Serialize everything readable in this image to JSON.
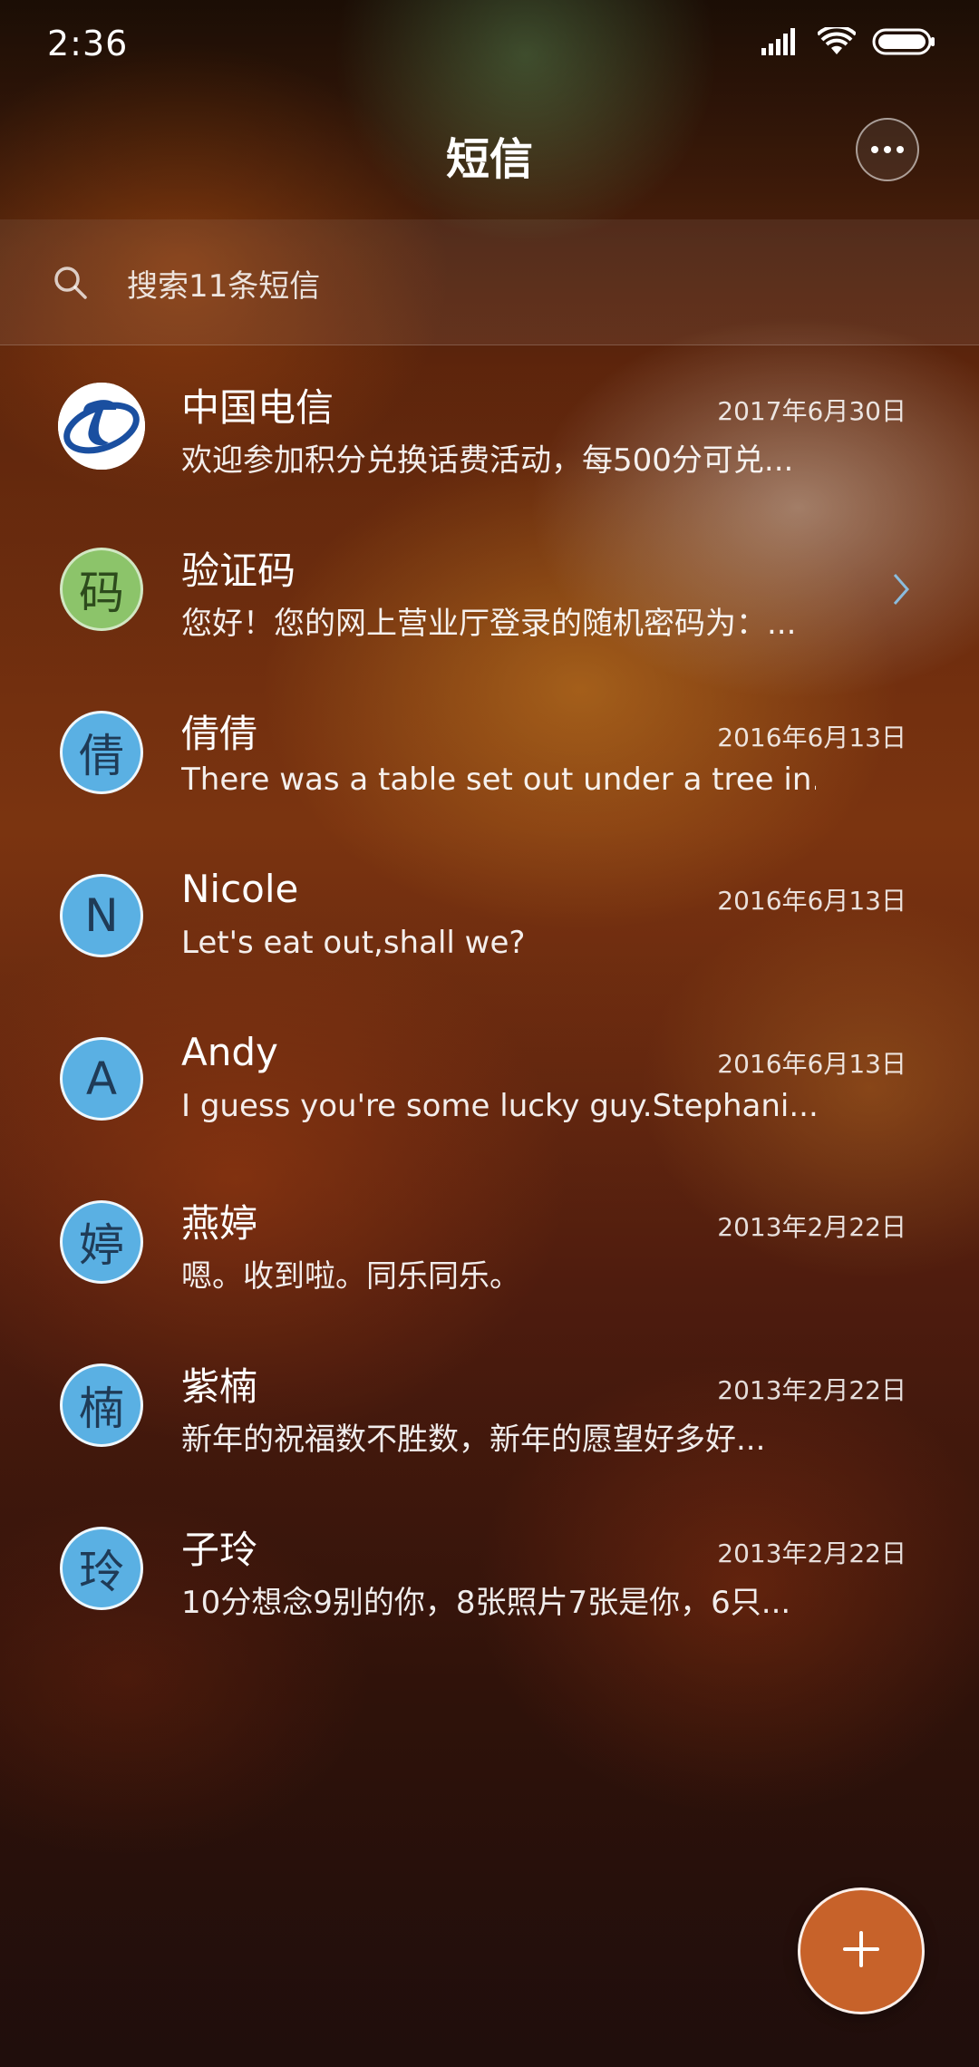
{
  "status_bar": {
    "time": "2:36"
  },
  "header": {
    "title": "短信"
  },
  "search": {
    "placeholder": "搜索11条短信"
  },
  "conversations": [
    {
      "name": "中国电信",
      "preview": "欢迎参加积分兑换话费活动，每500分可兑...",
      "date": "2017年6月30日",
      "avatar": "china-telecom-logo"
    },
    {
      "name": "验证码",
      "preview": "您好！您的网上营业厅登录的随机密码为：...",
      "date": "",
      "avatar_text": "码"
    },
    {
      "name": "倩倩",
      "preview": "There was a table set out under a tree in...",
      "date": "2016年6月13日",
      "avatar_text": "倩"
    },
    {
      "name": "Nicole",
      "preview": "Let's eat out,shall we?",
      "date": "2016年6月13日",
      "avatar_text": "N"
    },
    {
      "name": "Andy",
      "preview": "I guess you're some lucky guy.Stephani...",
      "date": "2016年6月13日",
      "avatar_text": "A"
    },
    {
      "name": "燕婷",
      "preview": "嗯。收到啦。同乐同乐。",
      "date": "2013年2月22日",
      "avatar_text": "婷"
    },
    {
      "name": "紫楠",
      "preview": "新年的祝福数不胜数，新年的愿望好多好...",
      "date": "2013年2月22日",
      "avatar_text": "楠"
    },
    {
      "name": "子玲",
      "preview": "10分想念9别的你，8张照片7张是你，6只...",
      "date": "2013年2月22日",
      "avatar_text": "玲"
    }
  ],
  "colors": {
    "avatar_blue": "#5ab0e3",
    "avatar_green": "#8cc46a",
    "fab": "#c7622a"
  },
  "icons": {
    "more": "more-icon",
    "search": "search-icon",
    "compose": "plus-icon",
    "chevron": "chevron-right-icon"
  }
}
